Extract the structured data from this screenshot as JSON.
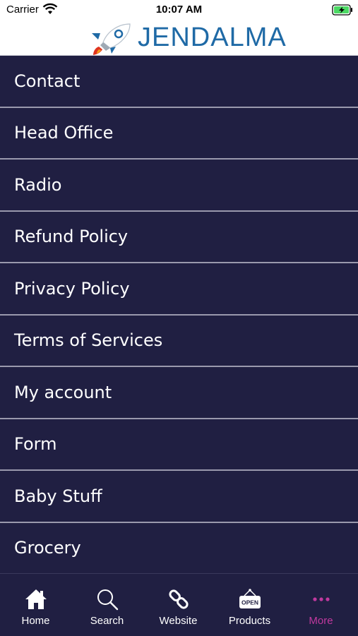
{
  "status_bar": {
    "carrier": "Carrier",
    "time": "10:07 AM"
  },
  "header": {
    "logo_text": "JENDALMA"
  },
  "menu": {
    "items": [
      {
        "label": "Contact"
      },
      {
        "label": "Head Office"
      },
      {
        "label": "Radio"
      },
      {
        "label": "Refund Policy"
      },
      {
        "label": "Privacy Policy"
      },
      {
        "label": "Terms of Services"
      },
      {
        "label": "My account"
      },
      {
        "label": "Form"
      },
      {
        "label": "Baby Stuff"
      },
      {
        "label": "Grocery"
      }
    ]
  },
  "tab_bar": {
    "tabs": [
      {
        "label": "Home",
        "icon": "home-icon"
      },
      {
        "label": "Search",
        "icon": "search-icon"
      },
      {
        "label": "Website",
        "icon": "link-icon"
      },
      {
        "label": "Products",
        "icon": "open-sign-icon"
      },
      {
        "label": "More",
        "icon": "more-icon",
        "active": true
      }
    ],
    "active_color": "#c0399e"
  },
  "colors": {
    "background": "#201f42",
    "divider": "#9a99ad",
    "logo_blue": "#1f6aa6"
  }
}
